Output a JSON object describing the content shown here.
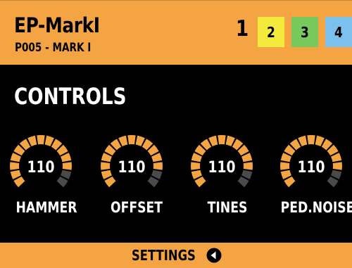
{
  "header": {
    "title": "EP-MarkI",
    "subtitle": "P005 - MARK I",
    "current_page": "1",
    "pages": [
      {
        "label": "2",
        "color": "#f4ea3c"
      },
      {
        "label": "3",
        "color": "#76c95a"
      },
      {
        "label": "4",
        "color": "#7cc0ee"
      }
    ],
    "accent_color": "#f5a444"
  },
  "section": {
    "title": "CONTROLS"
  },
  "knobs": [
    {
      "label": "HAMMER",
      "value": "110",
      "level": 0.866
    },
    {
      "label": "OFFSET",
      "value": "110",
      "level": 0.866
    },
    {
      "label": "TINES",
      "value": "110",
      "level": 0.866
    },
    {
      "label": "PED.NOISE",
      "value": "110",
      "level": 0.866
    }
  ],
  "footer": {
    "label": "SETTINGS",
    "icon": "back-arrow-icon"
  }
}
